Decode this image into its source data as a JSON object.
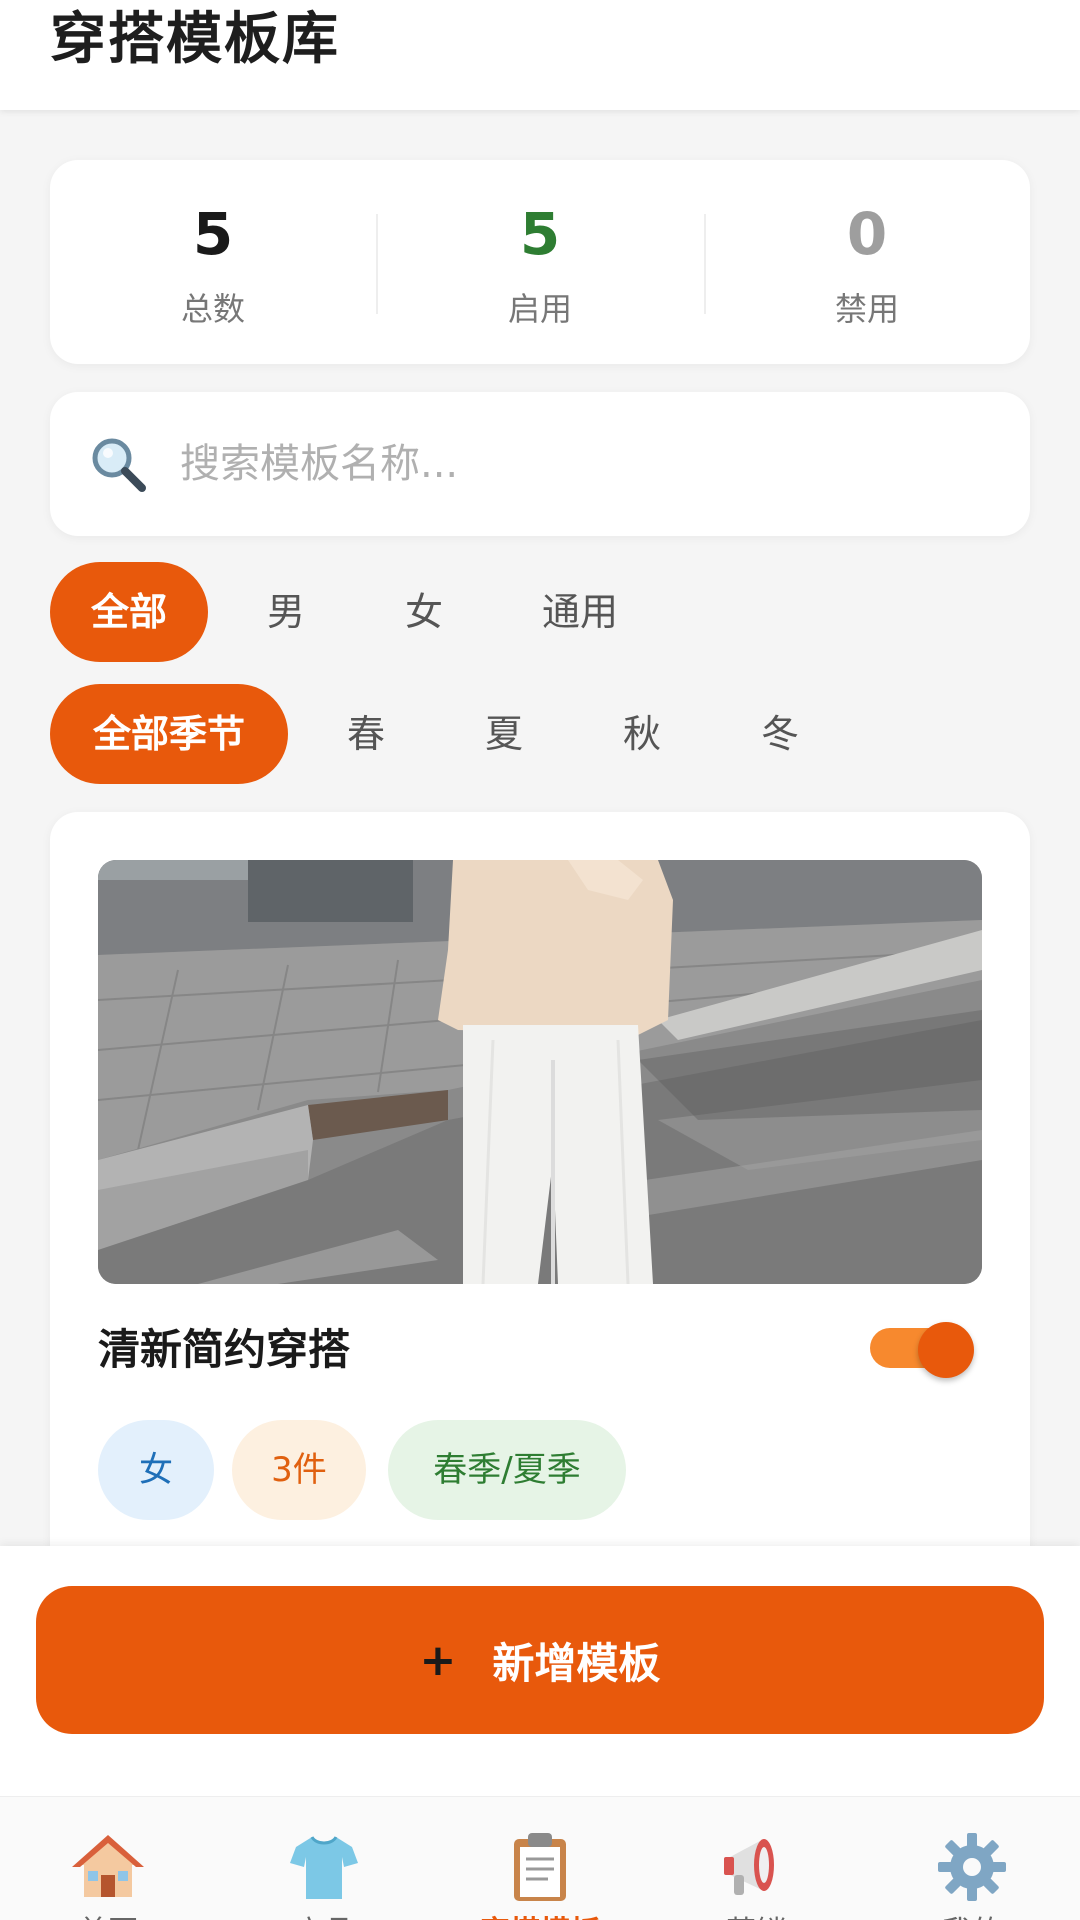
{
  "header": {
    "title": "穿搭模板库"
  },
  "stats": [
    {
      "value": "5",
      "label": "总数",
      "color": "#1a1a1a"
    },
    {
      "value": "5",
      "label": "启用",
      "color": "#2e7d32"
    },
    {
      "value": "0",
      "label": "禁用",
      "color": "#9e9e9e"
    }
  ],
  "search": {
    "placeholder": "搜索模板名称..."
  },
  "gender_filters": [
    {
      "label": "全部",
      "active": true
    },
    {
      "label": "男",
      "active": false
    },
    {
      "label": "女",
      "active": false
    },
    {
      "label": "通用",
      "active": false
    }
  ],
  "season_filters": [
    {
      "label": "全部季节",
      "active": true
    },
    {
      "label": "春",
      "active": false
    },
    {
      "label": "夏",
      "active": false
    },
    {
      "label": "秋",
      "active": false
    },
    {
      "label": "冬",
      "active": false
    }
  ],
  "template": {
    "name": "清新简约穿搭",
    "enabled": true,
    "tags": [
      {
        "text": "女",
        "color": "#1e6fb8",
        "bg": "#e3f0fc"
      },
      {
        "text": "3件",
        "color": "#e0600f",
        "bg": "#fdf0e0"
      },
      {
        "text": "春季/夏季",
        "color": "#2e7d32",
        "bg": "#e6f4e6"
      }
    ]
  },
  "add_button": {
    "plus": "+",
    "label": "新增模板"
  },
  "tab_bar": {
    "items": [
      {
        "label": "首页",
        "icon": "home-icon",
        "active": false
      },
      {
        "label": "商品",
        "icon": "tshirt-icon",
        "active": false
      },
      {
        "label": "穿搭模板",
        "icon": "clipboard-icon",
        "active": true
      },
      {
        "label": "营销",
        "icon": "megaphone-icon",
        "active": false
      },
      {
        "label": "我的",
        "icon": "gear-icon",
        "active": false
      }
    ]
  },
  "colors": {
    "accent": "#e8590c",
    "toggle_track": "#f7892e"
  }
}
